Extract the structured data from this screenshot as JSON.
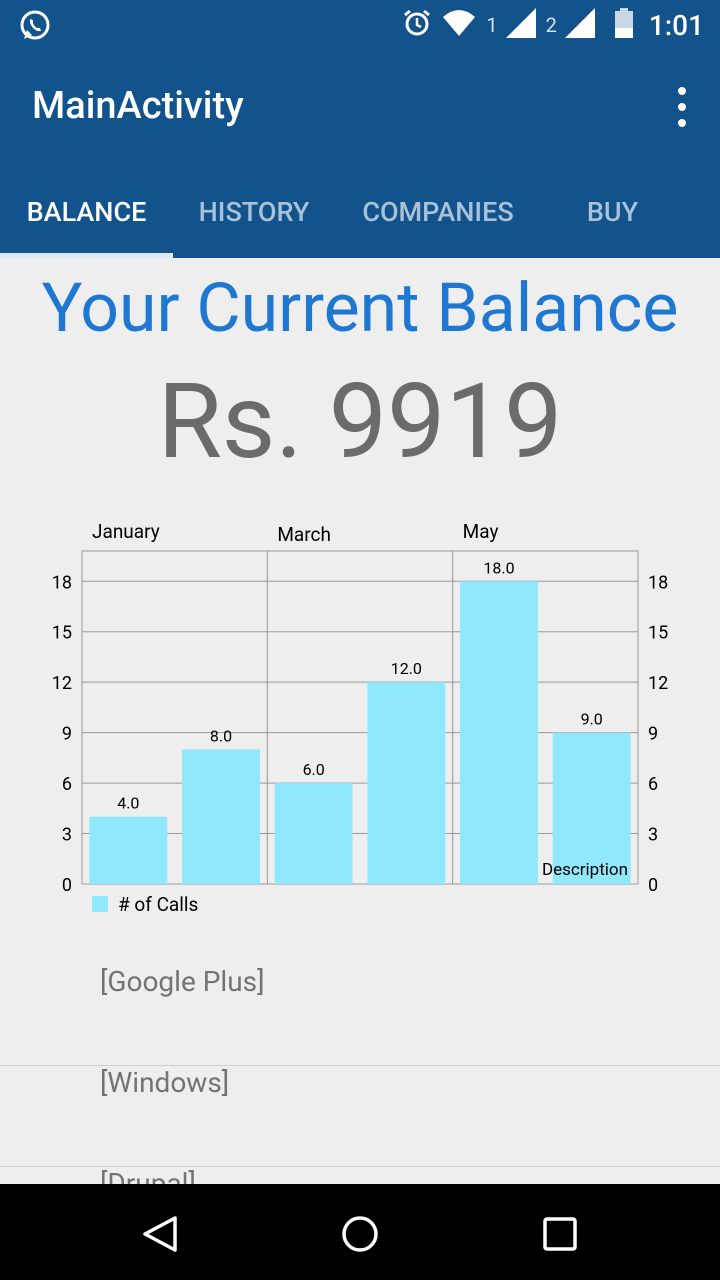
{
  "status_bar": {
    "time": "1:01",
    "sim1": "1",
    "sim2": "2",
    "icons": [
      "whatsapp-icon",
      "alarm-icon",
      "wifi-icon",
      "signal-icon",
      "battery-icon"
    ]
  },
  "app_bar": {
    "title": "MainActivity",
    "overflow_icon": "more-vert-icon",
    "tabs": [
      {
        "label": "BALANCE",
        "active": true
      },
      {
        "label": "HISTORY",
        "active": false
      },
      {
        "label": "COMPANIES",
        "active": false
      },
      {
        "label": "BUY",
        "active": false
      }
    ]
  },
  "main": {
    "headline": "Your Current Balance",
    "balance": "Rs. 9919"
  },
  "chart_data": {
    "type": "bar",
    "values": [
      4.0,
      8.0,
      6.0,
      12.0,
      18.0,
      9.0
    ],
    "value_labels": [
      "4.0",
      "8.0",
      "6.0",
      "12.0",
      "18.0",
      "9.0"
    ],
    "top_labels": [
      "January",
      "March",
      "May"
    ],
    "yticks": [
      "0",
      "3",
      "6",
      "9",
      "12",
      "15",
      "18"
    ],
    "ylim": [
      0,
      19.8
    ],
    "legend": "# of Calls",
    "description": "Description",
    "bar_color": "#8fe8fc",
    "grid": true,
    "legend_position": "bottom-left"
  },
  "list": {
    "items": [
      "[Google Plus]",
      "[Windows]",
      "[Drupal]"
    ]
  },
  "nav_bar": {
    "icons": [
      "back-icon",
      "home-icon",
      "recents-icon"
    ]
  },
  "colors": {
    "primary": "#11538a",
    "headline": "#1e78d2",
    "balance": "#6b6b6b",
    "background": "#eeeeee"
  }
}
